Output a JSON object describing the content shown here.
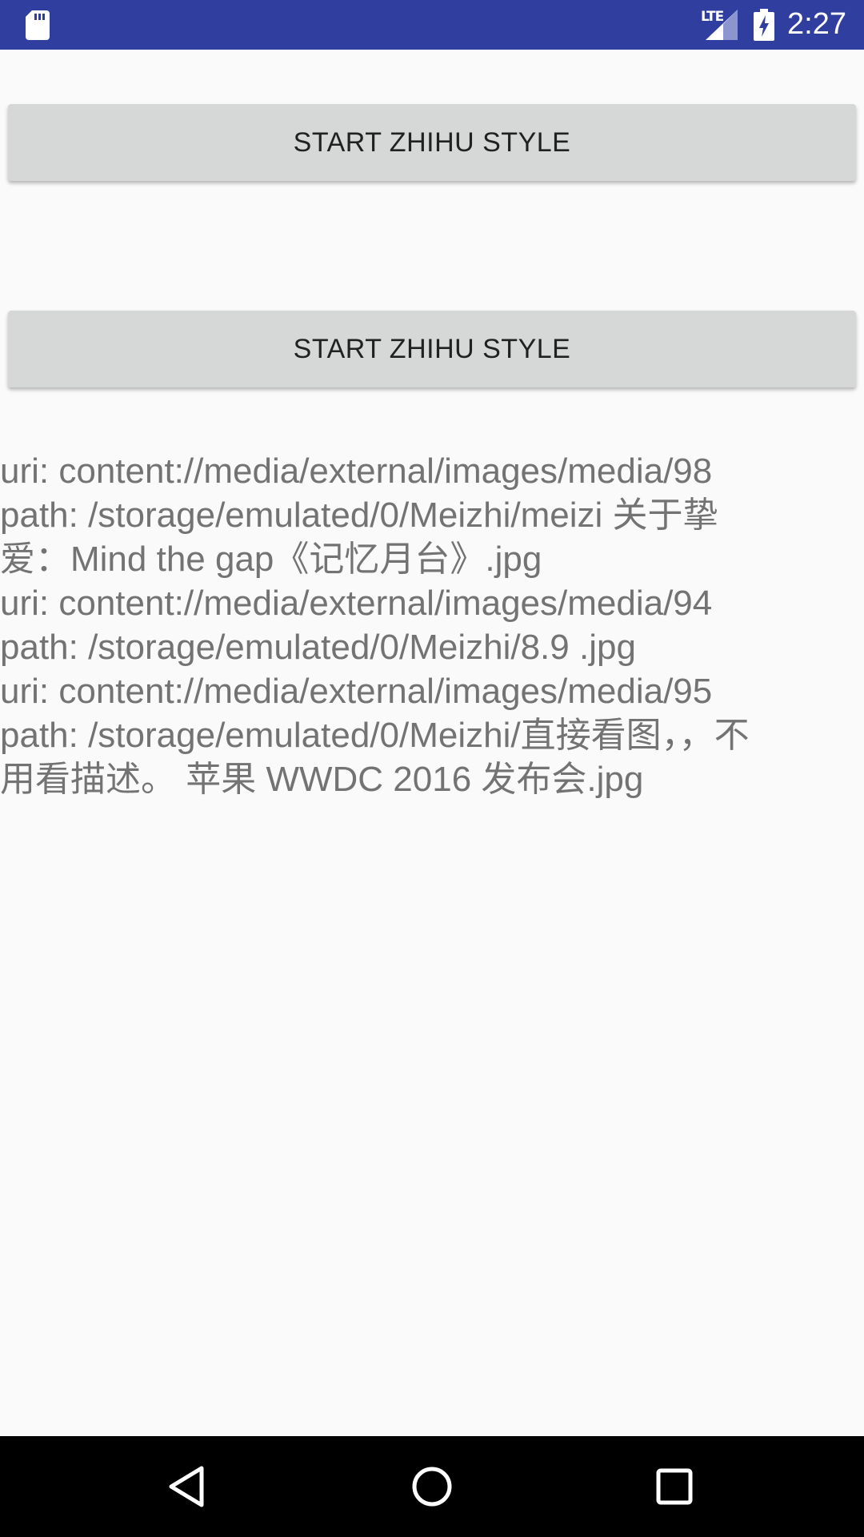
{
  "status_bar": {
    "time": "2:27",
    "network_label": "LTE",
    "icons": [
      "sd-card-icon",
      "lte-signal-icon",
      "battery-charging-icon"
    ]
  },
  "buttons": {
    "first_label": "START ZHIHU STYLE",
    "second_label": "START ZHIHU STYLE"
  },
  "log": {
    "lines": [
      "uri: content://media/external/images/media/98",
      "path: /storage/emulated/0/Meizhi/meizi 关于挚",
      "爱：Mind the gap《记忆月台》.jpg",
      "uri: content://media/external/images/media/94",
      "path: /storage/emulated/0/Meizhi/8.9 .jpg",
      "uri: content://media/external/images/media/95",
      "path: /storage/emulated/0/Meizhi/直接看图，，不",
      "用看描述。 苹果 WWDC 2016 发布会.jpg"
    ]
  },
  "nav_bar": {
    "icons": [
      "back-icon",
      "home-icon",
      "recents-icon"
    ]
  },
  "colors": {
    "status_bar": "#303f9f",
    "background": "#fafafa",
    "button": "#d6d7d7",
    "button_text": "#212121",
    "log_text": "#737373",
    "nav_bar": "#000000"
  }
}
